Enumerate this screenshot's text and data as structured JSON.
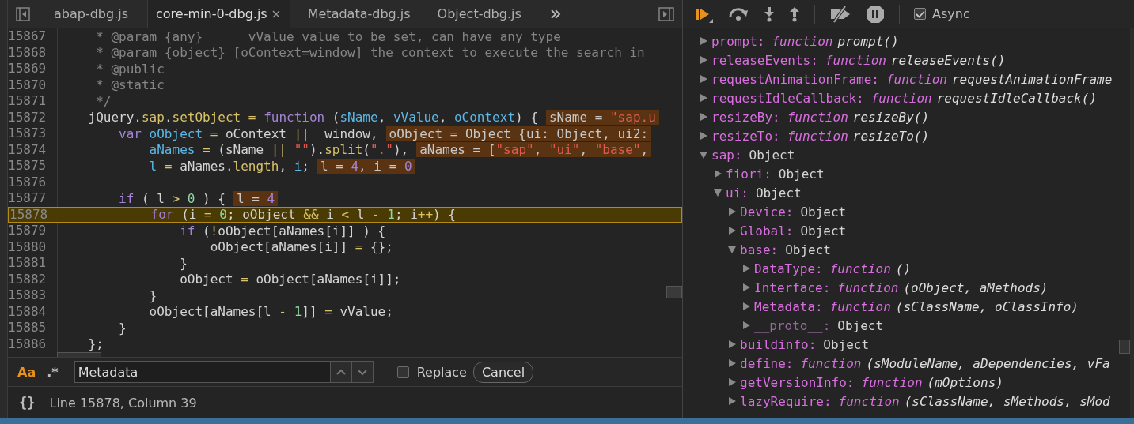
{
  "editor": {
    "tabs": [
      {
        "label": "abap-dbg.js",
        "selected": false,
        "closable": false
      },
      {
        "label": "core-min-0-dbg.js",
        "selected": true,
        "closable": true
      },
      {
        "label": "Metadata-dbg.js",
        "selected": false,
        "closable": false
      },
      {
        "label": "Object-dbg.js",
        "selected": false,
        "closable": false
      }
    ],
    "lines": [
      {
        "number": "15867",
        "current": false,
        "tokens": [
          {
            "t": "     * @param {any}      vValue value to be set, can have any type",
            "kind": "comment"
          }
        ]
      },
      {
        "number": "15868",
        "current": false,
        "tokens": [
          {
            "t": "     * @param {object} [oContext=window] the context to execute the search in",
            "kind": "comment"
          }
        ]
      },
      {
        "number": "15869",
        "current": false,
        "tokens": [
          {
            "t": "     * @public",
            "kind": "comment"
          }
        ]
      },
      {
        "number": "15870",
        "current": false,
        "tokens": [
          {
            "t": "     * @static",
            "kind": "comment"
          }
        ]
      },
      {
        "number": "15871",
        "current": false,
        "tokens": [
          {
            "t": "     */",
            "kind": "comment"
          }
        ]
      },
      {
        "number": "15872",
        "current": false,
        "tokens": [
          {
            "t": "    jQuery.",
            "kind": "plain"
          },
          {
            "t": "sap",
            "kind": "prop"
          },
          {
            "t": ".",
            "kind": "plain"
          },
          {
            "t": "setObject",
            "kind": "prop"
          },
          {
            "t": " = ",
            "kind": "op"
          },
          {
            "t": "function",
            "kind": "kw"
          },
          {
            "t": " (",
            "kind": "plain"
          },
          {
            "t": "sName",
            "kind": "var"
          },
          {
            "t": ", ",
            "kind": "plain"
          },
          {
            "t": "vValue",
            "kind": "var"
          },
          {
            "t": ", ",
            "kind": "plain"
          },
          {
            "t": "oContext",
            "kind": "var"
          },
          {
            "t": ") {",
            "kind": "plain"
          }
        ],
        "inline": [
          {
            "t": "sName = ",
            "kind": "plain"
          },
          {
            "t": "\"sap.u",
            "kind": "str"
          }
        ]
      },
      {
        "number": "15873",
        "current": false,
        "tokens": [
          {
            "t": "        var",
            "kind": "kw"
          },
          {
            "t": " oObject",
            "kind": "var"
          },
          {
            "t": " = ",
            "kind": "op"
          },
          {
            "t": "oContext ",
            "kind": "plain"
          },
          {
            "t": "||",
            "kind": "op"
          },
          {
            "t": " _window,",
            "kind": "plain"
          }
        ],
        "inline": [
          {
            "t": "oObject = Object {ui: Object, ui2:",
            "kind": "plain"
          }
        ]
      },
      {
        "number": "15874",
        "current": false,
        "tokens": [
          {
            "t": "            aNames",
            "kind": "var"
          },
          {
            "t": " = ",
            "kind": "op"
          },
          {
            "t": "(sName ",
            "kind": "plain"
          },
          {
            "t": "||",
            "kind": "op"
          },
          {
            "t": " \"\"",
            "kind": "str"
          },
          {
            "t": ").",
            "kind": "plain"
          },
          {
            "t": "split",
            "kind": "prop"
          },
          {
            "t": "(",
            "kind": "plain"
          },
          {
            "t": "\".\"",
            "kind": "str"
          },
          {
            "t": "),",
            "kind": "plain"
          }
        ],
        "inline": [
          {
            "t": "aNames = [",
            "kind": "plain"
          },
          {
            "t": "\"sap\"",
            "kind": "str"
          },
          {
            "t": ", ",
            "kind": "plain"
          },
          {
            "t": "\"ui\"",
            "kind": "str"
          },
          {
            "t": ", ",
            "kind": "plain"
          },
          {
            "t": "\"base\"",
            "kind": "str"
          },
          {
            "t": ",",
            "kind": "plain"
          }
        ]
      },
      {
        "number": "15875",
        "current": false,
        "tokens": [
          {
            "t": "            l",
            "kind": "var"
          },
          {
            "t": " = ",
            "kind": "op"
          },
          {
            "t": "aNames.",
            "kind": "plain"
          },
          {
            "t": "length",
            "kind": "prop"
          },
          {
            "t": ", ",
            "kind": "plain"
          },
          {
            "t": "i",
            "kind": "var"
          },
          {
            "t": ";",
            "kind": "plain"
          }
        ],
        "inline": [
          {
            "t": "l = ",
            "kind": "plain"
          },
          {
            "t": "4",
            "kind": "num"
          },
          {
            "t": ", i = ",
            "kind": "plain"
          },
          {
            "t": "0",
            "kind": "num"
          }
        ]
      },
      {
        "number": "15876",
        "current": false
      },
      {
        "number": "15877",
        "current": false,
        "tokens": [
          {
            "t": "        if",
            "kind": "kw"
          },
          {
            "t": " ( l ",
            "kind": "plain"
          },
          {
            "t": ">",
            "kind": "op"
          },
          {
            "t": " 0",
            "kind": "num"
          },
          {
            "t": " ) {",
            "kind": "plain"
          }
        ],
        "inline": [
          {
            "t": "l = ",
            "kind": "plain"
          },
          {
            "t": "4",
            "kind": "num"
          }
        ]
      },
      {
        "number": "15878",
        "current": true,
        "tokens": [
          {
            "t": "            for",
            "kind": "kw"
          },
          {
            "t": " (i ",
            "kind": "plain"
          },
          {
            "t": "=",
            "kind": "op"
          },
          {
            "t": " 0",
            "kind": "num"
          },
          {
            "t": "; oObject ",
            "kind": "plain"
          },
          {
            "t": "&&",
            "kind": "op"
          },
          {
            "t": " i ",
            "kind": "plain"
          },
          {
            "t": "<",
            "kind": "op"
          },
          {
            "t": " l ",
            "kind": "plain"
          },
          {
            "t": "-",
            "kind": "op"
          },
          {
            "t": " 1",
            "kind": "num"
          },
          {
            "t": "; i",
            "kind": "plain"
          },
          {
            "t": "++",
            "kind": "op"
          },
          {
            "t": ") {",
            "kind": "plain"
          }
        ]
      },
      {
        "number": "15879",
        "current": false,
        "tokens": [
          {
            "t": "                if",
            "kind": "kw"
          },
          {
            "t": " (",
            "kind": "plain"
          },
          {
            "t": "!",
            "kind": "op"
          },
          {
            "t": "oObject[aNames[i]] ) {",
            "kind": "plain"
          }
        ]
      },
      {
        "number": "15880",
        "current": false,
        "tokens": [
          {
            "t": "                    oObject[aNames[i]] ",
            "kind": "plain"
          },
          {
            "t": "=",
            "kind": "op"
          },
          {
            "t": " {};",
            "kind": "plain"
          }
        ]
      },
      {
        "number": "15881",
        "current": false,
        "tokens": [
          {
            "t": "                }",
            "kind": "plain"
          }
        ]
      },
      {
        "number": "15882",
        "current": false,
        "tokens": [
          {
            "t": "                oObject ",
            "kind": "plain"
          },
          {
            "t": "=",
            "kind": "op"
          },
          {
            "t": " oObject[aNames[i]];",
            "kind": "plain"
          }
        ]
      },
      {
        "number": "15883",
        "current": false,
        "tokens": [
          {
            "t": "            }",
            "kind": "plain"
          }
        ]
      },
      {
        "number": "15884",
        "current": false,
        "tokens": [
          {
            "t": "            oObject[aNames[l ",
            "kind": "plain"
          },
          {
            "t": "-",
            "kind": "op"
          },
          {
            "t": " 1",
            "kind": "num"
          },
          {
            "t": "]] ",
            "kind": "plain"
          },
          {
            "t": "=",
            "kind": "op"
          },
          {
            "t": " vValue;",
            "kind": "plain"
          }
        ]
      },
      {
        "number": "15885",
        "current": false,
        "tokens": [
          {
            "t": "        }",
            "kind": "plain"
          }
        ]
      },
      {
        "number": "15886",
        "current": false,
        "tokens": [
          {
            "t": "    };",
            "kind": "plain"
          }
        ]
      }
    ],
    "search": {
      "match_case_label": "Aa",
      "match_case": true,
      "regex_label": ".*",
      "regex": false,
      "value": "Metadata",
      "replace_checked": false,
      "replace_label": "Replace",
      "cancel_label": "Cancel"
    },
    "status_bar": {
      "format_glyph": "{}",
      "position": "Line 15878, Column 39"
    }
  },
  "debugger": {
    "toolbar": {
      "async_checked": true,
      "async_label": "Async"
    },
    "scope_tree": [
      {
        "label": "prompt:",
        "kind": "function",
        "value": "function",
        "signature": "prompt()",
        "expanded": false
      },
      {
        "label": "releaseEvents:",
        "kind": "function",
        "value": "function",
        "signature": "releaseEvents()",
        "expanded": false
      },
      {
        "label": "requestAnimationFrame:",
        "kind": "function",
        "value": "function",
        "signature": "requestAnimationFrame",
        "expanded": false
      },
      {
        "label": "requestIdleCallback:",
        "kind": "function",
        "value": "function",
        "signature": "requestIdleCallback()",
        "expanded": false
      },
      {
        "label": "resizeBy:",
        "kind": "function",
        "value": "function",
        "signature": "resizeBy()",
        "expanded": false
      },
      {
        "label": "resizeTo:",
        "kind": "function",
        "value": "function",
        "signature": "resizeTo()",
        "expanded": false
      },
      {
        "label": "sap:",
        "kind": "object",
        "value": "Object",
        "expanded": true,
        "children": [
          {
            "label": "fiori:",
            "kind": "object",
            "value": "Object",
            "expanded": false
          },
          {
            "label": "ui:",
            "kind": "object",
            "value": "Object",
            "expanded": true,
            "children": [
              {
                "label": "Device:",
                "kind": "object",
                "value": "Object",
                "expanded": false
              },
              {
                "label": "Global:",
                "kind": "object",
                "value": "Object",
                "expanded": false
              },
              {
                "label": "base:",
                "kind": "object",
                "value": "Object",
                "expanded": true,
                "children": [
                  {
                    "label": "DataType:",
                    "kind": "function",
                    "value": "function",
                    "signature": "()",
                    "expanded": false
                  },
                  {
                    "label": "Interface:",
                    "kind": "function",
                    "value": "function",
                    "signature": "(oObject, aMethods)",
                    "expanded": false
                  },
                  {
                    "label": "Metadata:",
                    "kind": "function",
                    "value": "function",
                    "signature": "(sClassName, oClassInfo)",
                    "expanded": false
                  },
                  {
                    "label": "__proto__:",
                    "kind": "internal",
                    "value": "Object",
                    "expanded": false
                  }
                ]
              },
              {
                "label": "buildinfo:",
                "kind": "object",
                "value": "Object",
                "expanded": false
              },
              {
                "label": "define:",
                "kind": "function",
                "value": "function",
                "signature": "(sModuleName, aDependencies, vFa",
                "expanded": false
              },
              {
                "label": "getVersionInfo:",
                "kind": "function",
                "value": "function",
                "signature": "(mOptions)",
                "expanded": false
              },
              {
                "label": "lazyRequire:",
                "kind": "function",
                "value": "function",
                "signature": "(sClassName, sMethods, sMod",
                "expanded": false
              }
            ]
          }
        ]
      }
    ]
  }
}
